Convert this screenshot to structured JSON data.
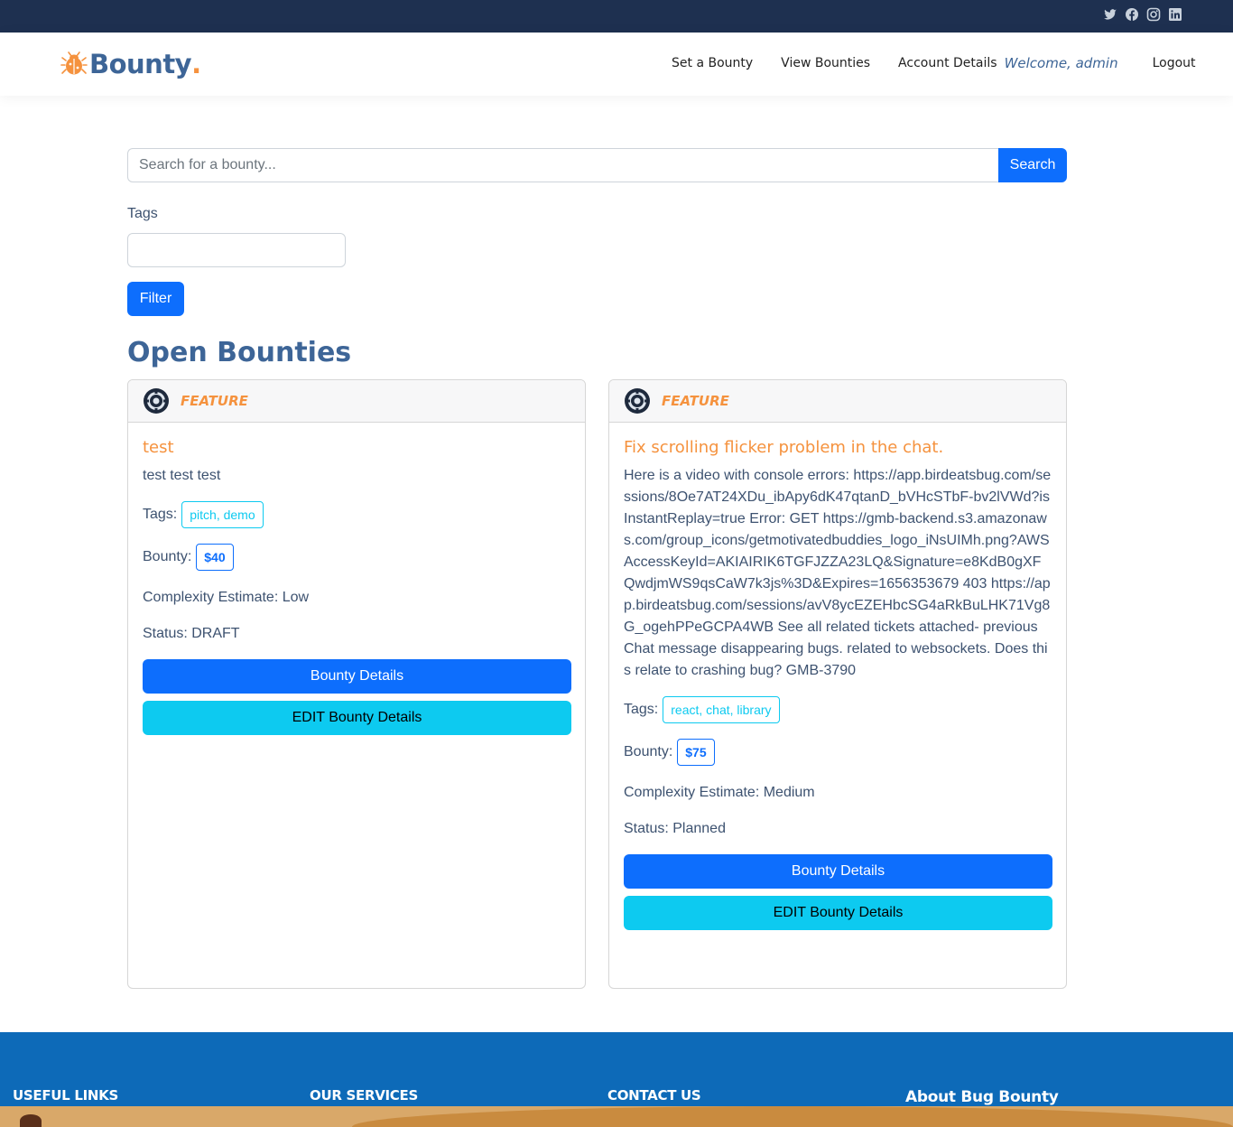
{
  "social": {
    "icons": [
      "twitter-icon",
      "facebook-icon",
      "instagram-icon",
      "linkedin-icon"
    ]
  },
  "header": {
    "brand": "Bounty",
    "brand_dot": ".",
    "nav": {
      "set_bounty": "Set a Bounty",
      "view_bounties": "View Bounties",
      "account_details": "Account Details",
      "welcome": "Welcome, admin",
      "logout": "Logout"
    }
  },
  "search": {
    "placeholder": "Search for a bounty...",
    "button": "Search"
  },
  "filter": {
    "tags_label": "Tags",
    "tags_value": "",
    "button": "Filter"
  },
  "section_title": "Open Bounties",
  "bounties": [
    {
      "type": "FEATURE",
      "title": "test",
      "description": "test test test",
      "tags_label": "Tags:",
      "tags": "pitch, demo",
      "bounty_label": "Bounty:",
      "amount": "$40",
      "complexity": "Complexity Estimate: Low",
      "status": "Status: DRAFT",
      "details_button": "Bounty Details",
      "edit_button": "EDIT Bounty Details"
    },
    {
      "type": "FEATURE",
      "title": "Fix scrolling flicker problem in the chat.",
      "description": "Here is a video with console errors: https://app.birdeatsbug.com/sessions/8Oe7AT24XDu_ibApy6dK47qtanD_bVHcSTbF-bv2lVWd?isInstantReplay=true Error: GET https://gmb-backend.s3.amazonaws.com/group_icons/getmotivatedbuddies_logo_iNsUIMh.png?AWSAccessKeyId=AKIAIRIK6TGFJZZA23LQ&Signature=e8KdB0gXFQwdjmWS9qsCaW7k3js%3D&Expires=1656353679 403 https://app.birdeatsbug.com/sessions/avV8ycEZEHbcSG4aRkBuLHK71Vg8G_ogehPPeGCPA4WB See all related tickets attached- previous Chat message disappearing bugs. related to websockets. Does this relate to crashing bug? GMB-3790",
      "tags_label": "Tags:",
      "tags": "react, chat, library",
      "bounty_label": "Bounty:",
      "amount": "$75",
      "complexity": "Complexity Estimate: Medium",
      "status": "Status: Planned",
      "details_button": "Bounty Details",
      "edit_button": "EDIT Bounty Details"
    }
  ],
  "footer": {
    "useful_links": "USEFUL LINKS",
    "our_services": "OUR SERVICES",
    "contact_us": "CONTACT US",
    "about": "About Bug Bounty"
  },
  "colors": {
    "topbar": "#1e3050",
    "brand": "#3d6597",
    "accent_orange": "#f5923e",
    "primary": "#0d6efd",
    "info": "#0dcaf0",
    "footer": "#0d6ab8"
  }
}
